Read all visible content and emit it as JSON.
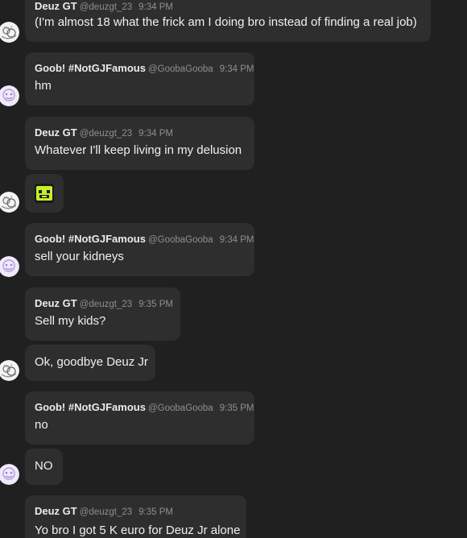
{
  "messages": [
    {
      "author": "Deuz GT",
      "handle": "@deuzgt_23",
      "time": "9:34 PM",
      "text": "(I'm almost 18 what the frick am I doing bro instead of finding a real job)"
    },
    {
      "author": "Goob! #NotGJFamous",
      "handle": "@GoobaGooba",
      "time": "9:34 PM",
      "text": "hm"
    },
    {
      "author": "Deuz GT",
      "handle": "@deuzgt_23",
      "time": "9:34 PM",
      "text": "Whatever I'll keep living in my delusion"
    },
    {
      "emoji": "green-face-emoji"
    },
    {
      "author": "Goob! #NotGJFamous",
      "handle": "@GoobaGooba",
      "time": "9:34 PM",
      "text": "sell your kidneys"
    },
    {
      "author": "Deuz GT",
      "handle": "@deuzgt_23",
      "time": "9:35 PM",
      "text": "Sell my kids?"
    },
    {
      "text": "Ok, goodbye Deuz Jr"
    },
    {
      "author": "Goob! #NotGJFamous",
      "handle": "@GoobaGooba",
      "time": "9:35 PM",
      "text": "no"
    },
    {
      "text": "NO"
    },
    {
      "author": "Deuz GT",
      "handle": "@deuzgt_23",
      "time": "9:35 PM",
      "text": "Yo bro I got 5 K euro for Deuz Jr alone"
    }
  ],
  "colors": {
    "background": "#202020",
    "bubble": "#2e2e2e",
    "name": "#ececec",
    "meta": "#8f8f8f",
    "text": "#f0f0f0",
    "emoji_green": "#c6f02a"
  },
  "avatars": {
    "deuz": "white-circular-sketch-avatar",
    "goob": "lavender-circular-sketch-avatar"
  }
}
